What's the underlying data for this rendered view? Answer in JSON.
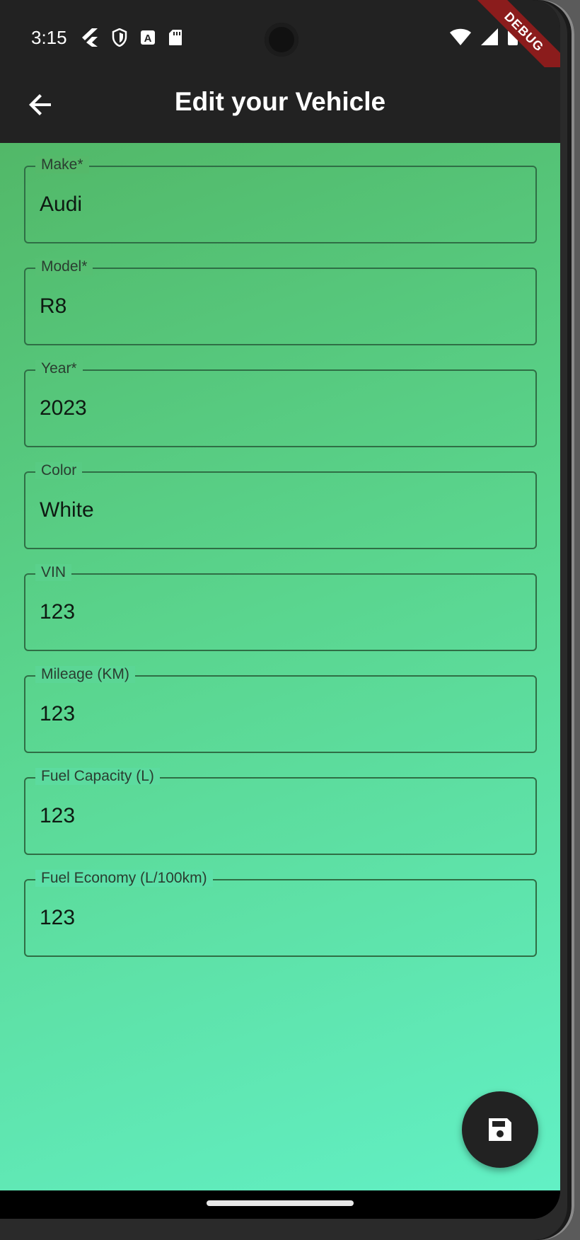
{
  "status_bar": {
    "time": "3:15",
    "debug_label": "DEBUG"
  },
  "app_bar": {
    "title": "Edit your Vehicle"
  },
  "form": {
    "fields": [
      {
        "label": "Make*",
        "value": "Audi"
      },
      {
        "label": "Model*",
        "value": "R8"
      },
      {
        "label": "Year*",
        "value": "2023"
      },
      {
        "label": "Color",
        "value": "White"
      },
      {
        "label": "VIN",
        "value": "123"
      },
      {
        "label": "Mileage (KM)",
        "value": "123"
      },
      {
        "label": "Fuel Capacity (L)",
        "value": "123"
      },
      {
        "label": "Fuel Economy (L/100km)",
        "value": "123"
      }
    ]
  },
  "fab": {
    "icon": "save-icon"
  },
  "colors": {
    "app_bar_bg": "#222222",
    "gradient_start": "#52b868",
    "gradient_end": "#62f0c5",
    "debug_ribbon": "#8b1c1c"
  }
}
